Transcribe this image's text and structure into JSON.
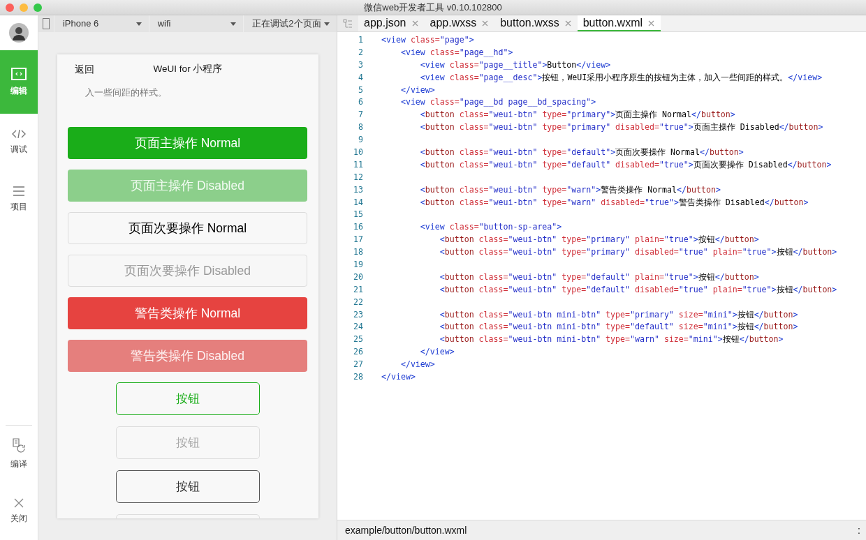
{
  "window": {
    "title": "微信web开发者工具 v0.10.102800"
  },
  "sidebar": {
    "items": [
      {
        "label": "编辑",
        "selected": true
      },
      {
        "label": "调试",
        "selected": false
      },
      {
        "label": "项目",
        "selected": false
      }
    ],
    "bottom_items": [
      {
        "label": "编译"
      },
      {
        "label": "关闭"
      }
    ]
  },
  "toolbar": {
    "device": "iPhone 6",
    "network": "wifi",
    "debug": "正在调试2个页面"
  },
  "simulator": {
    "back": "返回",
    "title": "WeUI for 小程序",
    "description": "入一些间距的样式。",
    "buttons": [
      {
        "label": "页面主操作 Normal",
        "kind": "primary",
        "disabled": false,
        "plain": false
      },
      {
        "label": "页面主操作 Disabled",
        "kind": "primary",
        "disabled": true,
        "plain": false
      },
      {
        "label": "页面次要操作 Normal",
        "kind": "default",
        "disabled": false,
        "plain": false
      },
      {
        "label": "页面次要操作 Disabled",
        "kind": "default",
        "disabled": true,
        "plain": false
      },
      {
        "label": "警告类操作 Normal",
        "kind": "warn",
        "disabled": false,
        "plain": false
      },
      {
        "label": "警告类操作 Disabled",
        "kind": "warn",
        "disabled": true,
        "plain": false
      },
      {
        "label": "按钮",
        "kind": "primary",
        "disabled": false,
        "plain": true
      },
      {
        "label": "按钮",
        "kind": "primary",
        "disabled": true,
        "plain": true
      },
      {
        "label": "按钮",
        "kind": "default",
        "disabled": false,
        "plain": true
      },
      {
        "kind": "default",
        "disabled": true,
        "plain": true
      }
    ]
  },
  "editor": {
    "tabs": [
      {
        "label": "app.json",
        "selected": false
      },
      {
        "label": "app.wxss",
        "selected": false
      },
      {
        "label": "button.wxss",
        "selected": false
      },
      {
        "label": "button.wxml",
        "selected": true
      }
    ],
    "lines": [
      {
        "number": "1",
        "tokens": [
          {
            "kind": "tag",
            "text": "<view"
          },
          {
            "kind": "attr",
            "text": " class="
          },
          {
            "kind": "str",
            "text": "\"page\""
          },
          {
            "kind": "tag",
            "text": ">"
          }
        ]
      },
      {
        "number": "2",
        "tokens": [
          {
            "kind": "tag",
            "text": "    <view"
          },
          {
            "kind": "attr",
            "text": " class="
          },
          {
            "kind": "str",
            "text": "\"page__hd\""
          },
          {
            "kind": "tag",
            "text": ">"
          }
        ]
      },
      {
        "number": "3",
        "tokens": [
          {
            "kind": "tag",
            "text": "        <view"
          },
          {
            "kind": "attr",
            "text": " class="
          },
          {
            "kind": "str",
            "text": "\"page__title\""
          },
          {
            "kind": "tag",
            "text": ">"
          },
          {
            "kind": "text",
            "text": "Button"
          },
          {
            "kind": "tag",
            "text": "</view>"
          }
        ]
      },
      {
        "number": "4",
        "tokens": [
          {
            "kind": "tag",
            "text": "        <view"
          },
          {
            "kind": "attr",
            "text": " class="
          },
          {
            "kind": "str",
            "text": "\"page__desc\""
          },
          {
            "kind": "tag",
            "text": ">"
          },
          {
            "kind": "text",
            "text": "按钮，WeUI采用小程序原生的按钮为主体，加入一些间距的样式。"
          },
          {
            "kind": "tag",
            "text": "</view>"
          }
        ]
      },
      {
        "number": "5",
        "tokens": [
          {
            "kind": "tag",
            "text": "    </view>"
          }
        ]
      },
      {
        "number": "6",
        "tokens": [
          {
            "kind": "tag",
            "text": "    <view"
          },
          {
            "kind": "attr",
            "text": " class="
          },
          {
            "kind": "str",
            "text": "\"page__bd page__bd_spacing\""
          },
          {
            "kind": "tag",
            "text": ">"
          }
        ]
      },
      {
        "number": "7",
        "tokens": [
          {
            "kind": "tag",
            "text": "        <"
          },
          {
            "kind": "name",
            "text": "button"
          },
          {
            "kind": "attr",
            "text": " class="
          },
          {
            "kind": "str",
            "text": "\"weui-btn\""
          },
          {
            "kind": "attr",
            "text": " type="
          },
          {
            "kind": "str",
            "text": "\"primary\""
          },
          {
            "kind": "tag",
            "text": ">"
          },
          {
            "kind": "text",
            "text": "页面主操作 Normal"
          },
          {
            "kind": "tag",
            "text": "</"
          },
          {
            "kind": "name",
            "text": "button"
          },
          {
            "kind": "tag",
            "text": ">"
          }
        ]
      },
      {
        "number": "8",
        "tokens": [
          {
            "kind": "tag",
            "text": "        <"
          },
          {
            "kind": "name",
            "text": "button"
          },
          {
            "kind": "attr",
            "text": " class="
          },
          {
            "kind": "str",
            "text": "\"weui-btn\""
          },
          {
            "kind": "attr",
            "text": " type="
          },
          {
            "kind": "str",
            "text": "\"primary\""
          },
          {
            "kind": "attr",
            "text": " disabled="
          },
          {
            "kind": "str",
            "text": "\"true\""
          },
          {
            "kind": "tag",
            "text": ">"
          },
          {
            "kind": "text",
            "text": "页面主操作 Disabled"
          },
          {
            "kind": "tag",
            "text": "</"
          },
          {
            "kind": "name",
            "text": "button"
          },
          {
            "kind": "tag",
            "text": ">"
          }
        ]
      },
      {
        "number": "9"
      },
      {
        "number": "10",
        "tokens": [
          {
            "kind": "tag",
            "text": "        <"
          },
          {
            "kind": "name",
            "text": "button"
          },
          {
            "kind": "attr",
            "text": " class="
          },
          {
            "kind": "str",
            "text": "\"weui-btn\""
          },
          {
            "kind": "attr",
            "text": " type="
          },
          {
            "kind": "str",
            "text": "\"default\""
          },
          {
            "kind": "tag",
            "text": ">"
          },
          {
            "kind": "text",
            "text": "页面次要操作 Normal"
          },
          {
            "kind": "tag",
            "text": "</"
          },
          {
            "kind": "name",
            "text": "button"
          },
          {
            "kind": "tag",
            "text": ">"
          }
        ]
      },
      {
        "number": "11",
        "tokens": [
          {
            "kind": "tag",
            "text": "        <"
          },
          {
            "kind": "name",
            "text": "button"
          },
          {
            "kind": "attr",
            "text": " class="
          },
          {
            "kind": "str",
            "text": "\"weui-btn\""
          },
          {
            "kind": "attr",
            "text": " type="
          },
          {
            "kind": "str",
            "text": "\"default\""
          },
          {
            "kind": "attr",
            "text": " disabled="
          },
          {
            "kind": "str",
            "text": "\"true\""
          },
          {
            "kind": "tag",
            "text": ">"
          },
          {
            "kind": "text",
            "text": "页面次要操作 Disabled"
          },
          {
            "kind": "tag",
            "text": "</"
          },
          {
            "kind": "name",
            "text": "button"
          },
          {
            "kind": "tag",
            "text": ">"
          }
        ]
      },
      {
        "number": "12"
      },
      {
        "number": "13",
        "tokens": [
          {
            "kind": "tag",
            "text": "        <"
          },
          {
            "kind": "name",
            "text": "button"
          },
          {
            "kind": "attr",
            "text": " class="
          },
          {
            "kind": "str",
            "text": "\"weui-btn\""
          },
          {
            "kind": "attr",
            "text": " type="
          },
          {
            "kind": "str",
            "text": "\"warn\""
          },
          {
            "kind": "tag",
            "text": ">"
          },
          {
            "kind": "text",
            "text": "警告类操作 Normal"
          },
          {
            "kind": "tag",
            "text": "</"
          },
          {
            "kind": "name",
            "text": "button"
          },
          {
            "kind": "tag",
            "text": ">"
          }
        ]
      },
      {
        "number": "14",
        "tokens": [
          {
            "kind": "tag",
            "text": "        <"
          },
          {
            "kind": "name",
            "text": "button"
          },
          {
            "kind": "attr",
            "text": " class="
          },
          {
            "kind": "str",
            "text": "\"weui-btn\""
          },
          {
            "kind": "attr",
            "text": " type="
          },
          {
            "kind": "str",
            "text": "\"warn\""
          },
          {
            "kind": "attr",
            "text": " disabled="
          },
          {
            "kind": "str",
            "text": "\"true\""
          },
          {
            "kind": "tag",
            "text": ">"
          },
          {
            "kind": "text",
            "text": "警告类操作 Disabled"
          },
          {
            "kind": "tag",
            "text": "</"
          },
          {
            "kind": "name",
            "text": "button"
          },
          {
            "kind": "tag",
            "text": ">"
          }
        ]
      },
      {
        "number": "15"
      },
      {
        "number": "16",
        "tokens": [
          {
            "kind": "tag",
            "text": "        <view"
          },
          {
            "kind": "attr",
            "text": " class="
          },
          {
            "kind": "str",
            "text": "\"button-sp-area\""
          },
          {
            "kind": "tag",
            "text": ">"
          }
        ]
      },
      {
        "number": "17",
        "tokens": [
          {
            "kind": "tag",
            "text": "            <"
          },
          {
            "kind": "name",
            "text": "button"
          },
          {
            "kind": "attr",
            "text": " class="
          },
          {
            "kind": "str",
            "text": "\"weui-btn\""
          },
          {
            "kind": "attr",
            "text": " type="
          },
          {
            "kind": "str",
            "text": "\"primary\""
          },
          {
            "kind": "attr",
            "text": " plain="
          },
          {
            "kind": "str",
            "text": "\"true\""
          },
          {
            "kind": "tag",
            "text": ">"
          },
          {
            "kind": "text",
            "text": "按钮"
          },
          {
            "kind": "tag",
            "text": "</"
          },
          {
            "kind": "name",
            "text": "button"
          },
          {
            "kind": "tag",
            "text": ">"
          }
        ]
      },
      {
        "number": "18",
        "tokens": [
          {
            "kind": "tag",
            "text": "            <"
          },
          {
            "kind": "name",
            "text": "button"
          },
          {
            "kind": "attr",
            "text": " class="
          },
          {
            "kind": "str",
            "text": "\"weui-btn\""
          },
          {
            "kind": "attr",
            "text": " type="
          },
          {
            "kind": "str",
            "text": "\"primary\""
          },
          {
            "kind": "attr",
            "text": " disabled="
          },
          {
            "kind": "str",
            "text": "\"true\""
          },
          {
            "kind": "attr",
            "text": " plain="
          },
          {
            "kind": "str",
            "text": "\"true\""
          },
          {
            "kind": "tag",
            "text": ">"
          },
          {
            "kind": "text",
            "text": "按钮"
          },
          {
            "kind": "tag",
            "text": "</"
          },
          {
            "kind": "name",
            "text": "button"
          },
          {
            "kind": "tag",
            "text": ">"
          }
        ]
      },
      {
        "number": "19"
      },
      {
        "number": "20",
        "tokens": [
          {
            "kind": "tag",
            "text": "            <"
          },
          {
            "kind": "name",
            "text": "button"
          },
          {
            "kind": "attr",
            "text": " class="
          },
          {
            "kind": "str",
            "text": "\"weui-btn\""
          },
          {
            "kind": "attr",
            "text": " type="
          },
          {
            "kind": "str",
            "text": "\"default\""
          },
          {
            "kind": "attr",
            "text": " plain="
          },
          {
            "kind": "str",
            "text": "\"true\""
          },
          {
            "kind": "tag",
            "text": ">"
          },
          {
            "kind": "text",
            "text": "按钮"
          },
          {
            "kind": "tag",
            "text": "</"
          },
          {
            "kind": "name",
            "text": "button"
          },
          {
            "kind": "tag",
            "text": ">"
          }
        ]
      },
      {
        "number": "21",
        "tokens": [
          {
            "kind": "tag",
            "text": "            <"
          },
          {
            "kind": "name",
            "text": "button"
          },
          {
            "kind": "attr",
            "text": " class="
          },
          {
            "kind": "str",
            "text": "\"weui-btn\""
          },
          {
            "kind": "attr",
            "text": " type="
          },
          {
            "kind": "str",
            "text": "\"default\""
          },
          {
            "kind": "attr",
            "text": " disabled="
          },
          {
            "kind": "str",
            "text": "\"true\""
          },
          {
            "kind": "attr",
            "text": " plain="
          },
          {
            "kind": "str",
            "text": "\"true\""
          },
          {
            "kind": "tag",
            "text": ">"
          },
          {
            "kind": "text",
            "text": "按钮"
          },
          {
            "kind": "tag",
            "text": "</"
          },
          {
            "kind": "name",
            "text": "button"
          },
          {
            "kind": "tag",
            "text": ">"
          }
        ]
      },
      {
        "number": "22"
      },
      {
        "number": "23",
        "tokens": [
          {
            "kind": "tag",
            "text": "            <"
          },
          {
            "kind": "name",
            "text": "button"
          },
          {
            "kind": "attr",
            "text": " class="
          },
          {
            "kind": "str",
            "text": "\"weui-btn mini-btn\""
          },
          {
            "kind": "attr",
            "text": " type="
          },
          {
            "kind": "str",
            "text": "\"primary\""
          },
          {
            "kind": "attr",
            "text": " size="
          },
          {
            "kind": "str",
            "text": "\"mini\""
          },
          {
            "kind": "tag",
            "text": ">"
          },
          {
            "kind": "text",
            "text": "按钮"
          },
          {
            "kind": "tag",
            "text": "</"
          },
          {
            "kind": "name",
            "text": "button"
          },
          {
            "kind": "tag",
            "text": ">"
          }
        ]
      },
      {
        "number": "24",
        "tokens": [
          {
            "kind": "tag",
            "text": "            <"
          },
          {
            "kind": "name",
            "text": "button"
          },
          {
            "kind": "attr",
            "text": " class="
          },
          {
            "kind": "str",
            "text": "\"weui-btn mini-btn\""
          },
          {
            "kind": "attr",
            "text": " type="
          },
          {
            "kind": "str",
            "text": "\"default\""
          },
          {
            "kind": "attr",
            "text": " size="
          },
          {
            "kind": "str",
            "text": "\"mini\""
          },
          {
            "kind": "tag",
            "text": ">"
          },
          {
            "kind": "text",
            "text": "按钮"
          },
          {
            "kind": "tag",
            "text": "</"
          },
          {
            "kind": "name",
            "text": "button"
          },
          {
            "kind": "tag",
            "text": ">"
          }
        ]
      },
      {
        "number": "25",
        "tokens": [
          {
            "kind": "tag",
            "text": "            <"
          },
          {
            "kind": "name",
            "text": "button"
          },
          {
            "kind": "attr",
            "text": " class="
          },
          {
            "kind": "str",
            "text": "\"weui-btn mini-btn\""
          },
          {
            "kind": "attr",
            "text": " type="
          },
          {
            "kind": "str",
            "text": "\"warn\""
          },
          {
            "kind": "attr",
            "text": " size="
          },
          {
            "kind": "str",
            "text": "\"mini\""
          },
          {
            "kind": "tag",
            "text": ">"
          },
          {
            "kind": "text",
            "text": "按钮"
          },
          {
            "kind": "tag",
            "text": "</"
          },
          {
            "kind": "name",
            "text": "button"
          },
          {
            "kind": "tag",
            "text": ">"
          }
        ]
      },
      {
        "number": "26",
        "tokens": [
          {
            "kind": "tag",
            "text": "        </view>"
          }
        ]
      },
      {
        "number": "27",
        "tokens": [
          {
            "kind": "tag",
            "text": "    </view>"
          }
        ]
      },
      {
        "number": "28",
        "tokens": [
          {
            "kind": "tag",
            "text": "</view>"
          }
        ]
      }
    ]
  },
  "status_bar": {
    "path": "example/button/button.wxml",
    "position": ":"
  }
}
